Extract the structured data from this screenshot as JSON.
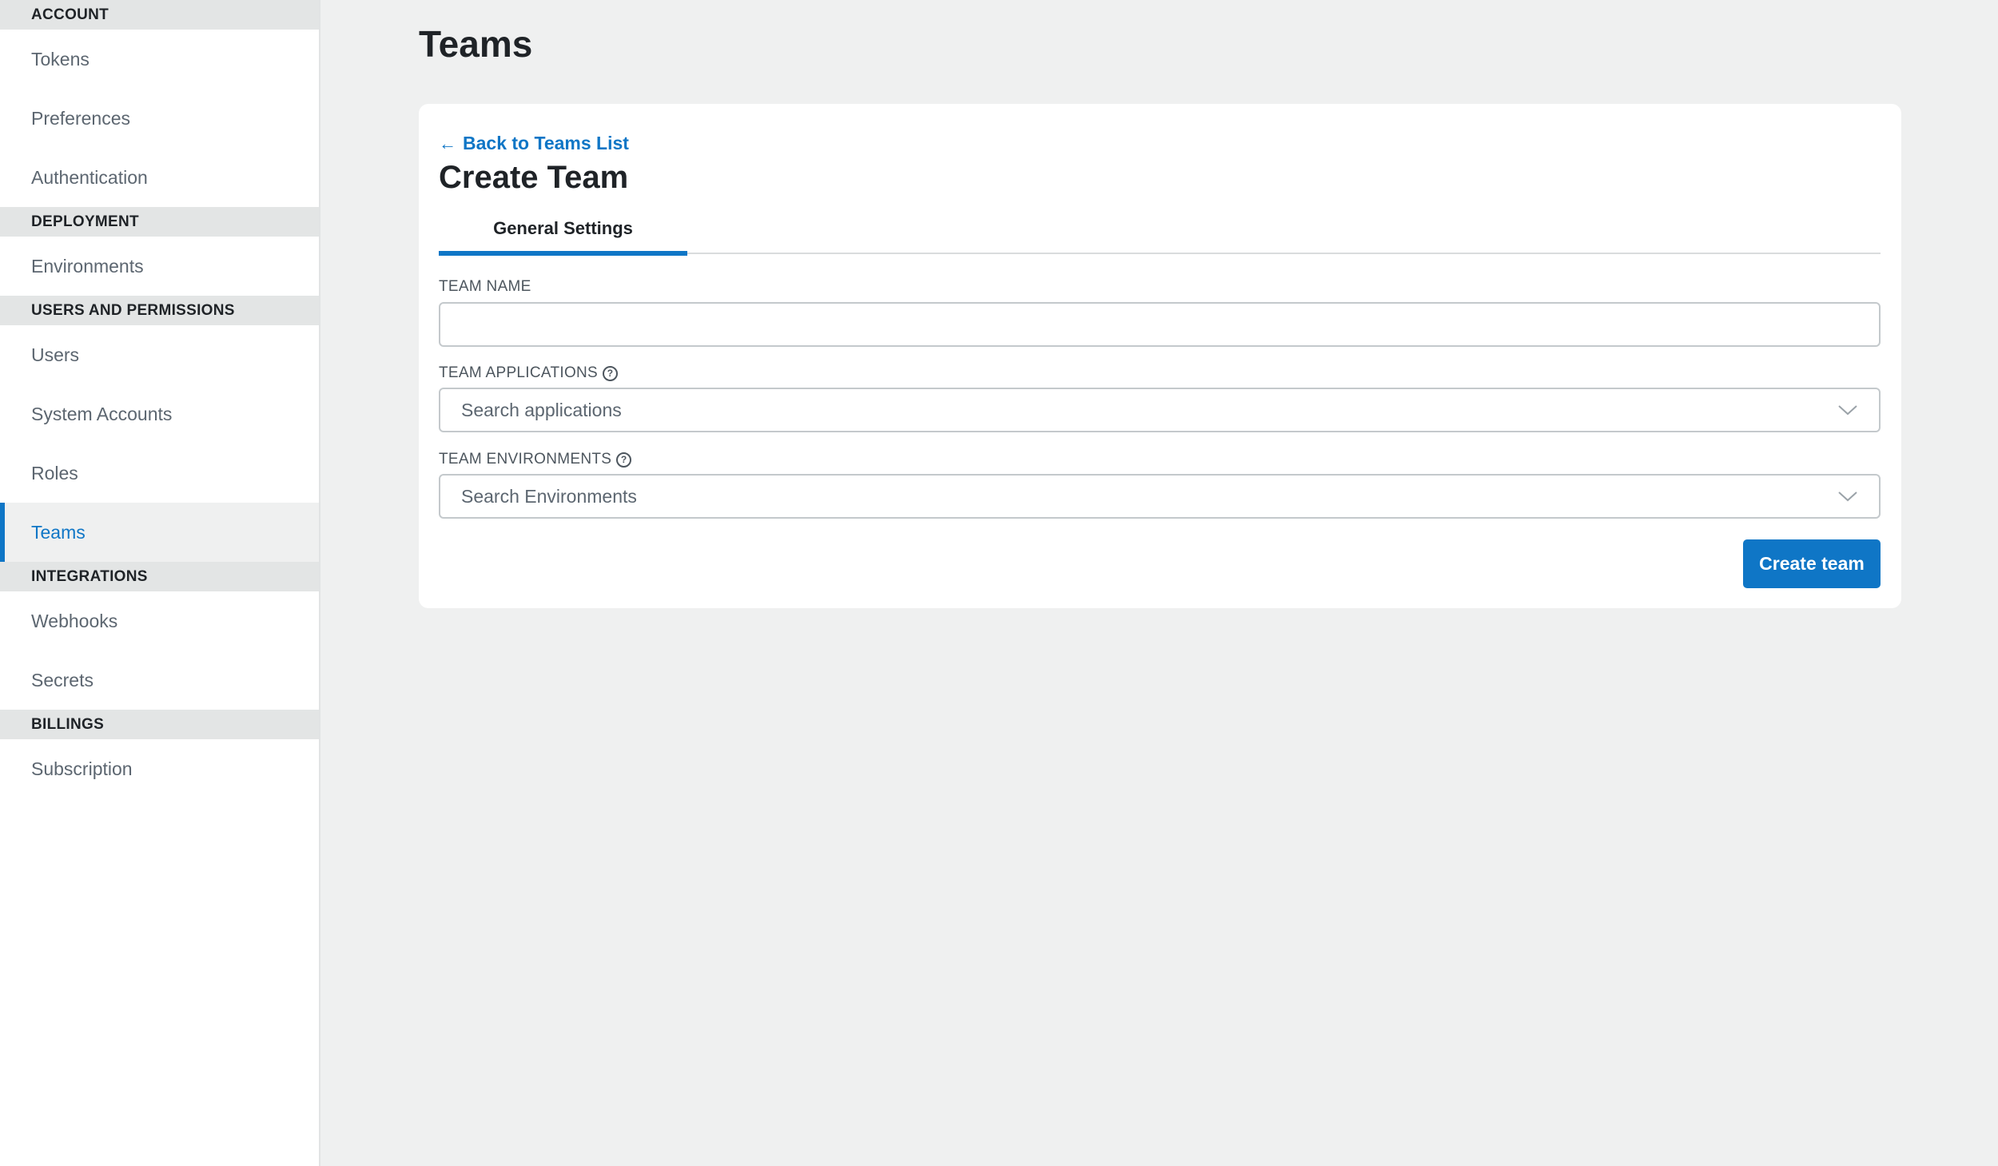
{
  "sidebar": {
    "sections": [
      {
        "title": "ACCOUNT",
        "items": [
          "Tokens",
          "Preferences",
          "Authentication"
        ]
      },
      {
        "title": "DEPLOYMENT",
        "items": [
          "Environments"
        ]
      },
      {
        "title": "USERS AND PERMISSIONS",
        "items": [
          "Users",
          "System Accounts",
          "Roles",
          "Teams"
        ]
      },
      {
        "title": "INTEGRATIONS",
        "items": [
          "Webhooks",
          "Secrets"
        ]
      },
      {
        "title": "BILLINGS",
        "items": [
          "Subscription"
        ]
      }
    ],
    "active_item": "Teams"
  },
  "page": {
    "title": "Teams"
  },
  "card": {
    "back_link": "Back to Teams List",
    "back_icon": "arrow-left-icon",
    "title": "Create Team",
    "tabs": [
      {
        "label": "General Settings",
        "active": true
      }
    ],
    "fields": {
      "team_name": {
        "label": "TEAM NAME",
        "value": "",
        "placeholder": ""
      },
      "team_applications": {
        "label": "TEAM APPLICATIONS",
        "placeholder": "Search applications",
        "help_icon": "help-circle-icon"
      },
      "team_environments": {
        "label": "TEAM ENVIRONMENTS",
        "placeholder": "Search Environments",
        "help_icon": "help-circle-icon"
      }
    },
    "submit_label": "Create team"
  },
  "colors": {
    "accent": "#0f76c6",
    "background": "#eff0f0",
    "section_header_bg": "#e3e5e5"
  }
}
